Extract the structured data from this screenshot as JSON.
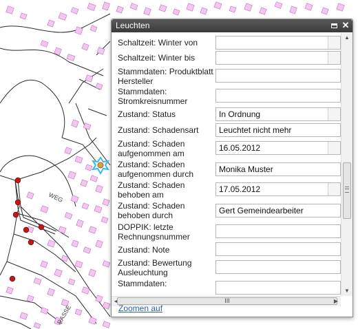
{
  "window": {
    "title": "Leuchten"
  },
  "fields": [
    {
      "label": "Schaltzeit: Winter von",
      "value": "",
      "dropdown": true
    },
    {
      "label": "Schaltzeit: Winter bis",
      "value": "",
      "dropdown": true
    },
    {
      "label": "Stammdaten: Produktblatt Hersteller",
      "value": "",
      "dropdown": false
    },
    {
      "label": "Stammdaten: Stromkreisnummer",
      "value": "",
      "dropdown": false
    },
    {
      "label": "Zustand: Status",
      "value": "In Ordnung",
      "dropdown": true
    },
    {
      "label": "Zustand: Schadensart",
      "value": "Leuchtet nicht mehr",
      "dropdown": false
    },
    {
      "label": "Zustand: Schaden aufgenommen am",
      "value": "16.05.2012",
      "dropdown": true
    },
    {
      "label": "Zustand: Schaden aufgenommen durch",
      "value": "Monika Muster",
      "dropdown": false
    },
    {
      "label": "Zustand: Schaden behoben am",
      "value": "17.05.2012",
      "dropdown": true
    },
    {
      "label": "Zustand: Schaden behoben durch",
      "value": "Gert Gemeindearbeiter",
      "dropdown": false
    },
    {
      "label": "DOPPIK: letzte Rechnungsnummer",
      "value": "",
      "dropdown": false
    },
    {
      "label": "Zustand: Note",
      "value": "",
      "dropdown": false
    },
    {
      "label": "Zustand: Bewertung Ausleuchtung",
      "value": "",
      "dropdown": false
    },
    {
      "label": "Stammdaten:",
      "value": "",
      "dropdown": false
    }
  ],
  "scrollbar": {
    "h_thumb_grip": "III"
  },
  "footer": {
    "zoom_link": "Zoomen auf"
  },
  "map": {
    "labels": [
      "WEG",
      "RASSE"
    ],
    "colors": {
      "building": "#f2c6ef",
      "building_stroke": "#c070c0",
      "line": "#2a2a2a",
      "marker": "#c0191c",
      "highlight": "#3ab8e8",
      "lamp": "#d2a44c"
    }
  }
}
